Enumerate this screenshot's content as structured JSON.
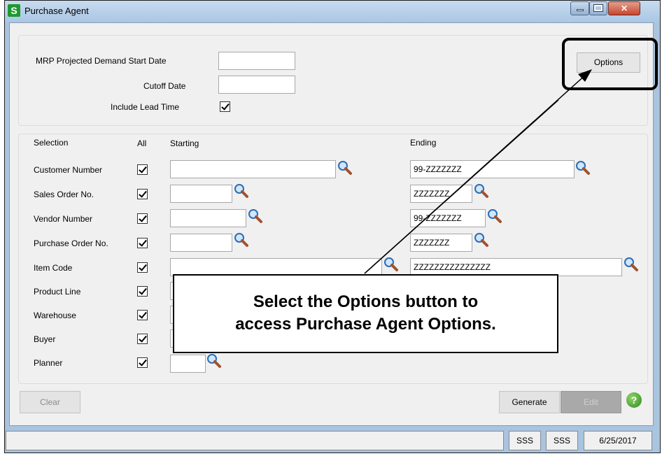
{
  "window": {
    "title": "Purchase Agent",
    "app_icon_letter": "S",
    "controls": [
      "minimize",
      "maximize",
      "close"
    ]
  },
  "header_group": {
    "mrp_start_label": "MRP Projected Demand Start Date",
    "mrp_start_value": "",
    "cutoff_label": "Cutoff Date",
    "cutoff_value": "",
    "lead_time_label": "Include Lead Time",
    "lead_time_checked": true,
    "options_button": "Options"
  },
  "selection": {
    "columns": {
      "selection": "Selection",
      "all": "All",
      "starting": "Starting",
      "ending": "Ending"
    },
    "rows": [
      {
        "label": "Customer Number",
        "all": true,
        "starting": "",
        "ending": "99-ZZZZZZZ"
      },
      {
        "label": "Sales Order No.",
        "all": true,
        "starting": "",
        "ending": "ZZZZZZZ"
      },
      {
        "label": "Vendor Number",
        "all": true,
        "starting": "",
        "ending": "99-ZZZZZZZ"
      },
      {
        "label": "Purchase Order No.",
        "all": true,
        "starting": "",
        "ending": "ZZZZZZZ"
      },
      {
        "label": "Item Code",
        "all": true,
        "starting": "",
        "ending": "ZZZZZZZZZZZZZZZ"
      },
      {
        "label": "Product Line",
        "all": true,
        "starting": "",
        "ending": ""
      },
      {
        "label": "Warehouse",
        "all": true,
        "starting": "",
        "ending": ""
      },
      {
        "label": "Buyer",
        "all": true,
        "starting": "",
        "ending": ""
      },
      {
        "label": "Planner",
        "all": true,
        "starting": "",
        "ending": ""
      }
    ]
  },
  "buttons": {
    "clear": "Clear",
    "generate": "Generate",
    "edit": "Edit",
    "help_icon": "help-icon"
  },
  "statusbar": {
    "cell1": "SSS",
    "cell2": "SSS",
    "date": "6/25/2017"
  },
  "callout": {
    "line1": "Select the Options button to",
    "line2": "access Purchase Agent Options."
  },
  "colors": {
    "titlebar": "#a9c6e4",
    "close_button": "#c9452d",
    "help_icon": "#2d8a1d"
  }
}
